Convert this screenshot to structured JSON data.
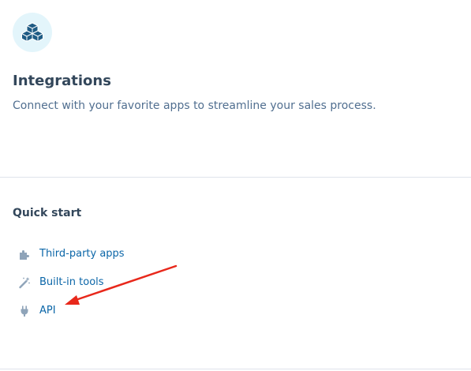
{
  "header": {
    "icon": "cubes-icon",
    "title": "Integrations",
    "subtitle": "Connect with your favorite apps to streamline your sales process."
  },
  "quick_start": {
    "title": "Quick start",
    "items": [
      {
        "label": "Third-party apps",
        "icon": "puzzle-piece-icon"
      },
      {
        "label": "Built-in tools",
        "icon": "magic-wand-icon"
      },
      {
        "label": "API",
        "icon": "plug-icon"
      }
    ]
  },
  "colors": {
    "accent_link": "#0b66a8",
    "annotation_arrow": "#e8281b",
    "icon_circle_bg": "#e3f5fb"
  }
}
